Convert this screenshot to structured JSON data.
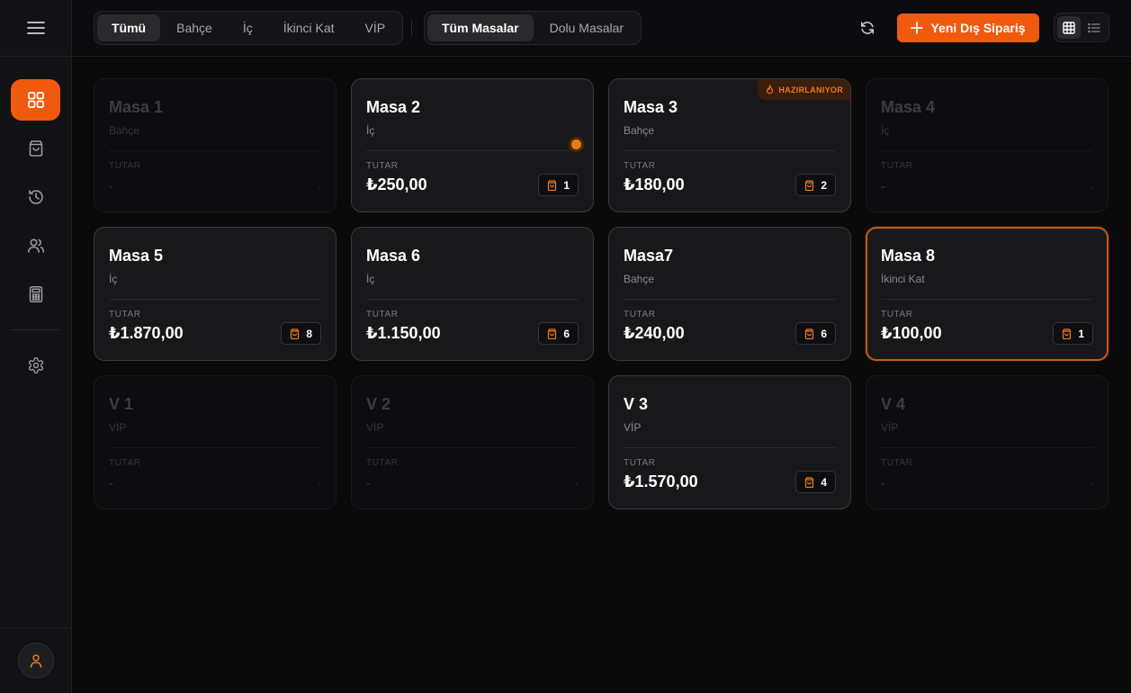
{
  "sidebar": {
    "items": [
      {
        "name": "dashboard",
        "active": true
      },
      {
        "name": "orders",
        "active": false
      },
      {
        "name": "history",
        "active": false
      },
      {
        "name": "customers",
        "active": false
      },
      {
        "name": "calculator",
        "active": false
      },
      {
        "name": "settings",
        "active": false
      }
    ]
  },
  "topbar": {
    "area_filters": [
      "Tümü",
      "Bahçe",
      "İç",
      "İkinci Kat",
      "VİP"
    ],
    "area_active": "Tümü",
    "table_filters": [
      "Tüm Masalar",
      "Dolu Masalar"
    ],
    "table_active": "Tüm Masalar",
    "new_order_label": "Yeni Dış Sipariş",
    "view_mode": "grid"
  },
  "tables": [
    {
      "name": "Masa 1",
      "area": "Bahçe",
      "label": "TUTAR",
      "amount": "-",
      "count": "",
      "state": "empty"
    },
    {
      "name": "Masa 2",
      "area": "İç",
      "label": "TUTAR",
      "amount": "₺250,00",
      "count": "1",
      "state": "active",
      "dot": true
    },
    {
      "name": "Masa 3",
      "area": "Bahçe",
      "label": "TUTAR",
      "amount": "₺180,00",
      "count": "2",
      "state": "active",
      "badge": "HAZIRLANIYOR"
    },
    {
      "name": "Masa 4",
      "area": "İç",
      "label": "TUTAR",
      "amount": "-",
      "count": "",
      "state": "empty"
    },
    {
      "name": "Masa 5",
      "area": "İç",
      "label": "TUTAR",
      "amount": "₺1.870,00",
      "count": "8",
      "state": "active"
    },
    {
      "name": "Masa 6",
      "area": "İç",
      "label": "TUTAR",
      "amount": "₺1.150,00",
      "count": "6",
      "state": "active"
    },
    {
      "name": "Masa7",
      "area": "Bahçe",
      "label": "TUTAR",
      "amount": "₺240,00",
      "count": "6",
      "state": "active"
    },
    {
      "name": "Masa 8",
      "area": "İkinci Kat",
      "label": "TUTAR",
      "amount": "₺100,00",
      "count": "1",
      "state": "selected"
    },
    {
      "name": "V 1",
      "area": "VİP",
      "label": "TUTAR",
      "amount": "-",
      "count": "",
      "state": "empty"
    },
    {
      "name": "V 2",
      "area": "VİP",
      "label": "TUTAR",
      "amount": "-",
      "count": "",
      "state": "empty"
    },
    {
      "name": "V 3",
      "area": "VİP",
      "label": "TUTAR",
      "amount": "₺1.570,00",
      "count": "4",
      "state": "active"
    },
    {
      "name": "V 4",
      "area": "VİP",
      "label": "TUTAR",
      "amount": "-",
      "count": "",
      "state": "empty"
    }
  ],
  "colors": {
    "accent": "#f05a0f",
    "accent_text": "#f07a1c",
    "background": "#0a0a0b",
    "card": "#18181a"
  }
}
